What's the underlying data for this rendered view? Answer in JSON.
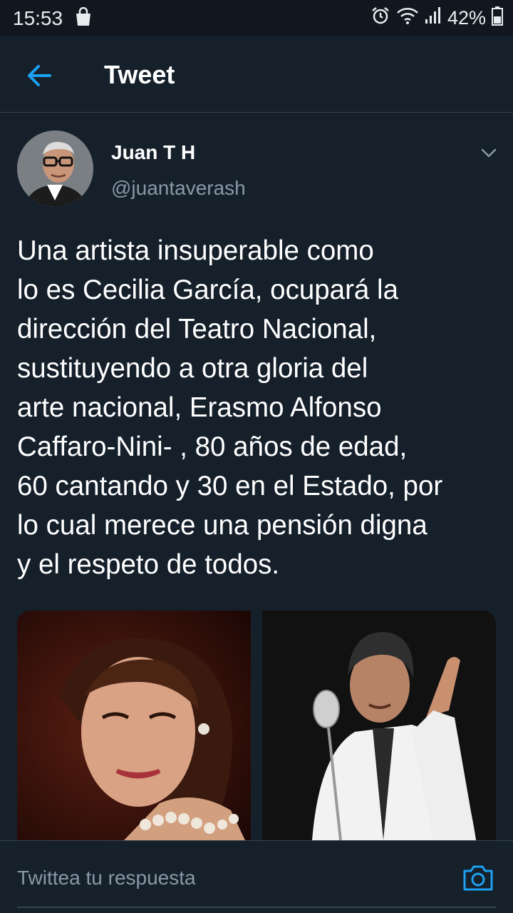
{
  "status_bar": {
    "time": "15:53",
    "battery": "42%",
    "icons": [
      "shopping-bag-icon",
      "alarm-icon",
      "wifi-icon",
      "signal-icon",
      "battery-icon"
    ]
  },
  "header": {
    "title": "Tweet",
    "back_icon": "back-arrow-icon"
  },
  "tweet": {
    "author_name": "Juan T H",
    "author_handle": "@juantaverash",
    "text": "Una artista insuperable como\nlo es Cecilia García, ocupará la\ndirección del Teatro Nacional,\nsustituyendo a otra gloria del\narte nacional, Erasmo Alfonso\nCaffaro-Nini- , 80 años de edad,\n60 cantando y 30 en el Estado, por\nlo cual merece una pensión digna\ny el respeto de todos.",
    "media": [
      {
        "description": "woman-portrait"
      },
      {
        "description": "man-singing-microphone"
      }
    ]
  },
  "reply": {
    "placeholder": "Twittea tu respuesta",
    "camera_icon": "camera-icon"
  },
  "colors": {
    "background": "#15202b",
    "accent": "#1da1f2",
    "secondary_text": "#8899a6",
    "divider": "#38444d"
  }
}
